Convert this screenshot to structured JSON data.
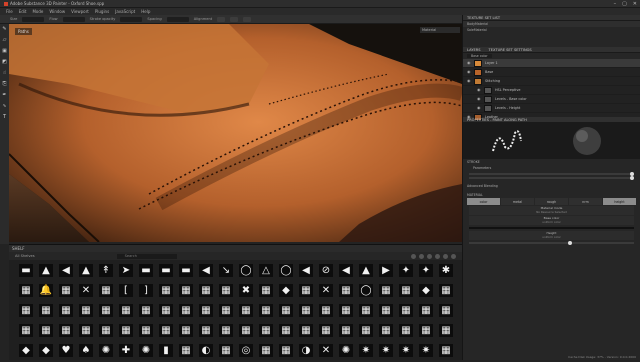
{
  "window": {
    "title": "Adobe Substance 3D Painter - Oxford Shoe.spp"
  },
  "menu": [
    "File",
    "Edit",
    "Mode",
    "Window",
    "Viewport",
    "Plugins",
    "JavaScript",
    "Help"
  ],
  "toolbar": {
    "items": [
      "Size",
      "Flow",
      "Stroke opacity",
      "Spacing",
      "Alignment"
    ]
  },
  "viewport": {
    "label": "Paths",
    "dropdown": "Material"
  },
  "shelf": {
    "title": "SHELF",
    "category": "All Shelves",
    "search_placeholder": "Search",
    "tiles": [
      {
        "g": "▬",
        "n": ""
      },
      {
        "g": "▲",
        "n": ""
      },
      {
        "g": "◀",
        "n": ""
      },
      {
        "g": "▲",
        "n": ""
      },
      {
        "g": "↟",
        "n": ""
      },
      {
        "g": "➤",
        "n": ""
      },
      {
        "g": "▬",
        "n": ""
      },
      {
        "g": "▬",
        "n": ""
      },
      {
        "g": "▬",
        "n": ""
      },
      {
        "g": "◀",
        "n": ""
      },
      {
        "g": "↘",
        "n": ""
      },
      {
        "g": "◯",
        "n": ""
      },
      {
        "g": "△",
        "n": ""
      },
      {
        "g": "◯",
        "n": ""
      },
      {
        "g": "◀",
        "n": ""
      },
      {
        "g": "⊘",
        "n": ""
      },
      {
        "g": "◀",
        "n": ""
      },
      {
        "g": "▲",
        "n": ""
      },
      {
        "g": "▶",
        "n": ""
      },
      {
        "g": "✦",
        "n": ""
      },
      {
        "g": "✦",
        "n": ""
      },
      {
        "g": "✱",
        "n": ""
      },
      {
        "g": "▦",
        "n": ""
      },
      {
        "g": "🔔",
        "n": ""
      },
      {
        "g": "▦",
        "n": ""
      },
      {
        "g": "✕",
        "n": ""
      },
      {
        "g": "▦",
        "n": ""
      },
      {
        "g": "[",
        "n": ""
      },
      {
        "g": "]",
        "n": ""
      },
      {
        "g": "▦",
        "n": ""
      },
      {
        "g": "▦",
        "n": ""
      },
      {
        "g": "▦",
        "n": ""
      },
      {
        "g": "▦",
        "n": ""
      },
      {
        "g": "✖",
        "n": ""
      },
      {
        "g": "▦",
        "n": ""
      },
      {
        "g": "◆",
        "n": ""
      },
      {
        "g": "▦",
        "n": ""
      },
      {
        "g": "✕",
        "n": ""
      },
      {
        "g": "▦",
        "n": ""
      },
      {
        "g": "◯",
        "n": ""
      },
      {
        "g": "▦",
        "n": ""
      },
      {
        "g": "▦",
        "n": ""
      },
      {
        "g": "◆",
        "n": ""
      },
      {
        "g": "▦",
        "n": ""
      },
      {
        "g": "▦",
        "n": ""
      },
      {
        "g": "▦",
        "n": ""
      },
      {
        "g": "▦",
        "n": ""
      },
      {
        "g": "▦",
        "n": ""
      },
      {
        "g": "▦",
        "n": ""
      },
      {
        "g": "▦",
        "n": ""
      },
      {
        "g": "▦",
        "n": ""
      },
      {
        "g": "▦",
        "n": ""
      },
      {
        "g": "▦",
        "n": ""
      },
      {
        "g": "▦",
        "n": ""
      },
      {
        "g": "▦",
        "n": ""
      },
      {
        "g": "▦",
        "n": ""
      },
      {
        "g": "▦",
        "n": ""
      },
      {
        "g": "▦",
        "n": ""
      },
      {
        "g": "▦",
        "n": ""
      },
      {
        "g": "▦",
        "n": ""
      },
      {
        "g": "▦",
        "n": ""
      },
      {
        "g": "▦",
        "n": ""
      },
      {
        "g": "▦",
        "n": ""
      },
      {
        "g": "▦",
        "n": ""
      },
      {
        "g": "▦",
        "n": ""
      },
      {
        "g": "▦",
        "n": ""
      },
      {
        "g": "▦",
        "n": ""
      },
      {
        "g": "▦",
        "n": ""
      },
      {
        "g": "▦",
        "n": ""
      },
      {
        "g": "▦",
        "n": ""
      },
      {
        "g": "▦",
        "n": ""
      },
      {
        "g": "▦",
        "n": ""
      },
      {
        "g": "▦",
        "n": ""
      },
      {
        "g": "▦",
        "n": ""
      },
      {
        "g": "▦",
        "n": ""
      },
      {
        "g": "▦",
        "n": ""
      },
      {
        "g": "▦",
        "n": ""
      },
      {
        "g": "▦",
        "n": ""
      },
      {
        "g": "▦",
        "n": ""
      },
      {
        "g": "▦",
        "n": ""
      },
      {
        "g": "▦",
        "n": ""
      },
      {
        "g": "▦",
        "n": ""
      },
      {
        "g": "▦",
        "n": ""
      },
      {
        "g": "▦",
        "n": ""
      },
      {
        "g": "▦",
        "n": ""
      },
      {
        "g": "▦",
        "n": ""
      },
      {
        "g": "▦",
        "n": ""
      },
      {
        "g": "▦",
        "n": ""
      },
      {
        "g": "◆",
        "n": ""
      },
      {
        "g": "◆",
        "n": ""
      },
      {
        "g": "♥",
        "n": ""
      },
      {
        "g": "♠",
        "n": ""
      },
      {
        "g": "✺",
        "n": ""
      },
      {
        "g": "✚",
        "n": ""
      },
      {
        "g": "✺",
        "n": ""
      },
      {
        "g": "▮",
        "n": ""
      },
      {
        "g": "▦",
        "n": ""
      },
      {
        "g": "◐",
        "n": ""
      },
      {
        "g": "▦",
        "n": ""
      },
      {
        "g": "◎",
        "n": ""
      },
      {
        "g": "▦",
        "n": ""
      },
      {
        "g": "▦",
        "n": ""
      },
      {
        "g": "◑",
        "n": ""
      },
      {
        "g": "✕",
        "n": ""
      },
      {
        "g": "✺",
        "n": ""
      },
      {
        "g": "✷",
        "n": ""
      },
      {
        "g": "✷",
        "n": ""
      },
      {
        "g": "✷",
        "n": ""
      },
      {
        "g": "✷",
        "n": ""
      },
      {
        "g": "▦",
        "n": ""
      }
    ]
  },
  "texture_set_list": {
    "title": "TEXTURE SET LIST",
    "items": [
      {
        "name": "BodyMaterial"
      },
      {
        "name": "SoleMaterial"
      }
    ]
  },
  "layers": {
    "tabs": [
      "LAYERS",
      "TEXTURE SET SETTINGS"
    ],
    "channel": "Base color",
    "rows": [
      {
        "name": "Layer 1",
        "color": "#d88a3a"
      },
      {
        "name": "Base",
        "color": "#b8642a"
      },
      {
        "name": "Stitching",
        "color": "#c07a34"
      },
      {
        "name": "HSL Perceptive",
        "color": "#555555"
      },
      {
        "name": "Levels - Base color",
        "color": "#555555"
      },
      {
        "name": "Levels - Height",
        "color": "#555555"
      },
      {
        "name": "Leather",
        "color": "#a65f2e"
      }
    ]
  },
  "properties": {
    "title": "PROPERTIES - PAINT ALONG PATH",
    "section1": "STROKE",
    "params_label": "Parameters",
    "advanced": "Advanced Blending",
    "material_label": "MATERIAL",
    "chips": [
      "color",
      "metal",
      "rough",
      "nrm",
      "height"
    ],
    "fields": [
      {
        "label": "Material mode",
        "sub": "No Resource Selected"
      },
      {
        "label": "Base color",
        "sub": "uniform color"
      },
      {
        "label": "Height",
        "sub": "uniform color"
      }
    ]
  },
  "status": "Cache Disk Usage: 37% - Version: 9.0.0.2000"
}
